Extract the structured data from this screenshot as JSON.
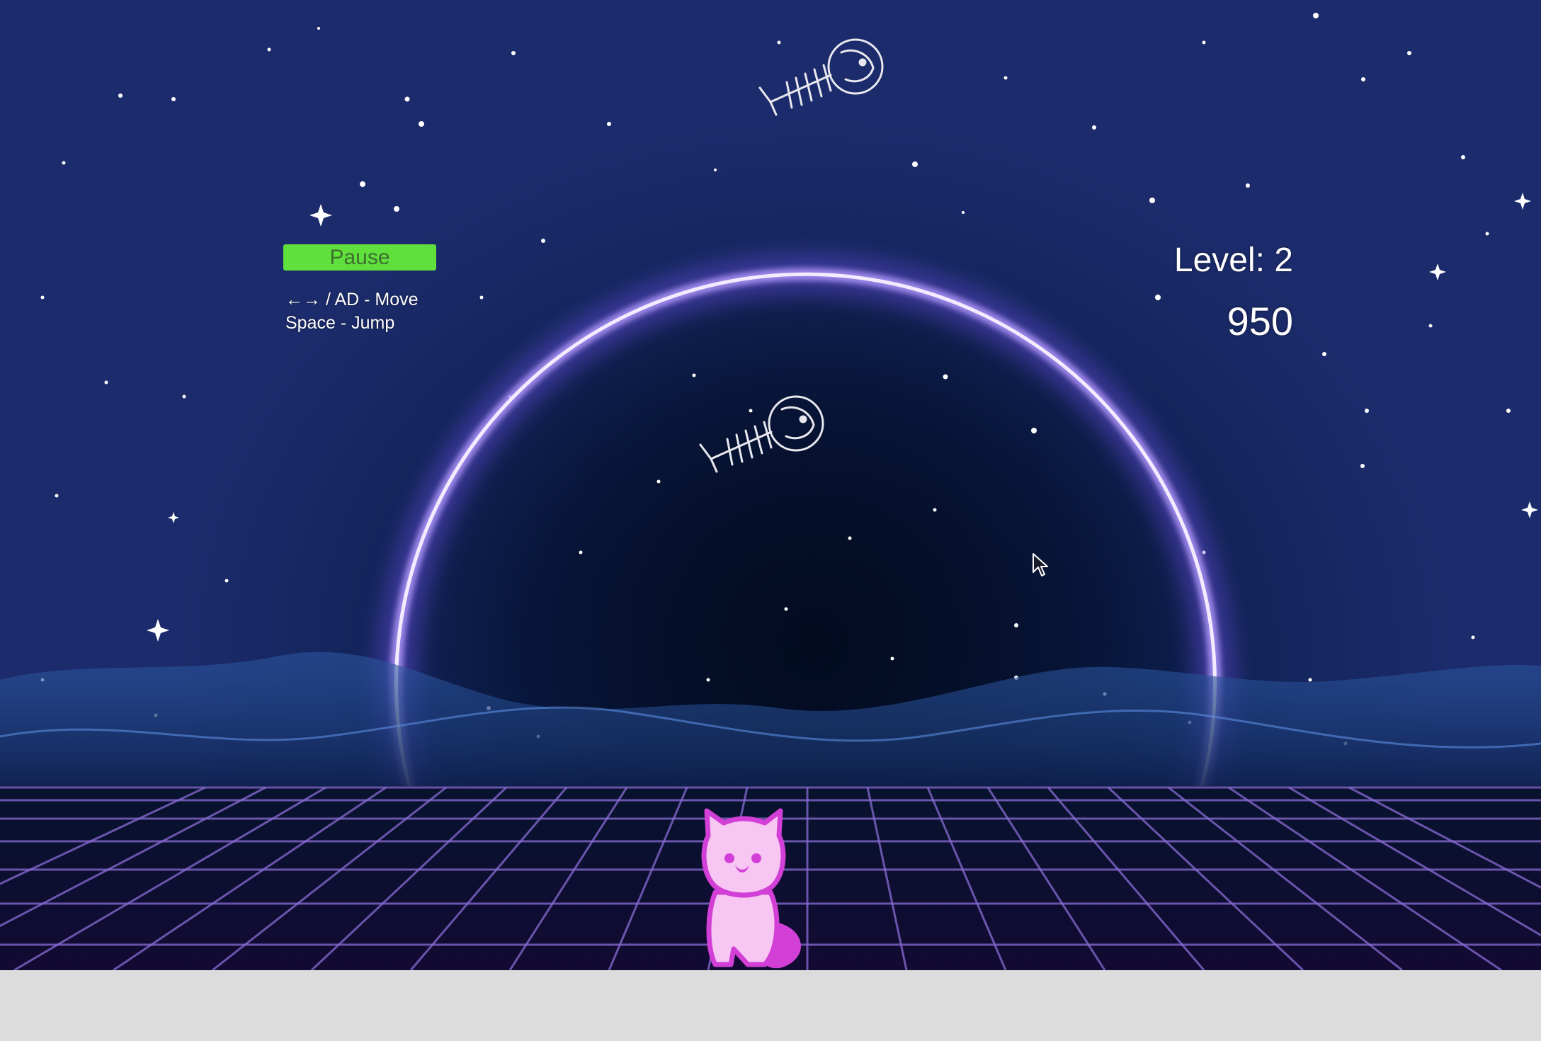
{
  "hud": {
    "pause_label": "Pause",
    "controls_move": "←→ / AD - Move",
    "controls_jump": "Space - Jump",
    "level_label": "Level: 2",
    "score": "950"
  },
  "sprites": {
    "fish_bone_icon": "fish-skeleton",
    "player_icon": "pink-cat",
    "cursor_icon": "mouse-pointer"
  },
  "colors": {
    "pause_button": "#5fe03c",
    "portal_glow": "#b59bff",
    "grid_lines": "#8a6cd6",
    "cat_fill": "#f7c6f3",
    "cat_outline": "#d23fd6"
  }
}
